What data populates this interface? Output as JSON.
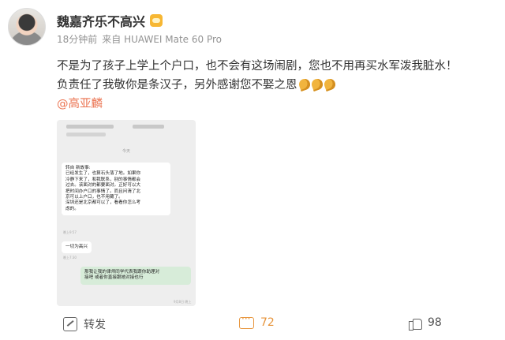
{
  "post": {
    "author": "魏嘉齐乐不高兴",
    "time": "18分钟前",
    "source": "来自 HUAWEI Mate 60 Pro",
    "text_line1": "不是为了孩子上学上个户口，也不会有这场闹剧，您也不用再买水军泼我脏水！",
    "text_line2": "负责任了我敬你是条汉子，另外感谢您不娶之恩",
    "mention": "@高亚麟"
  },
  "chat": {
    "time_divider": "今天",
    "message1": [
      "转自 新故事:",
      "已经发生了，也算石头落了地。如果你",
      "冷静下来了，和我联系，别的事情都会",
      "过去。该面对的都要面对。正好可以大",
      "把时间办户口的事情了。而且问清了北",
      "京可以上户口，也不用藏了。",
      "深圳还是北京都可以了，看看你怎么考",
      "虑的。"
    ],
    "message1_time": "晚上9:57",
    "message2": "一切为高兴",
    "message2_time": "晚上7:30",
    "message3": [
      "那我让我的律师同学代表我跟你助理对",
      "接吧 或者你直接跟她对接也行"
    ],
    "message3_time": "9月8日 晚上"
  },
  "actions": {
    "share_label": "转发",
    "comment_count": "72",
    "like_count": "98"
  },
  "colors": {
    "mention": "#eb7350",
    "comment": "#e7963e"
  }
}
